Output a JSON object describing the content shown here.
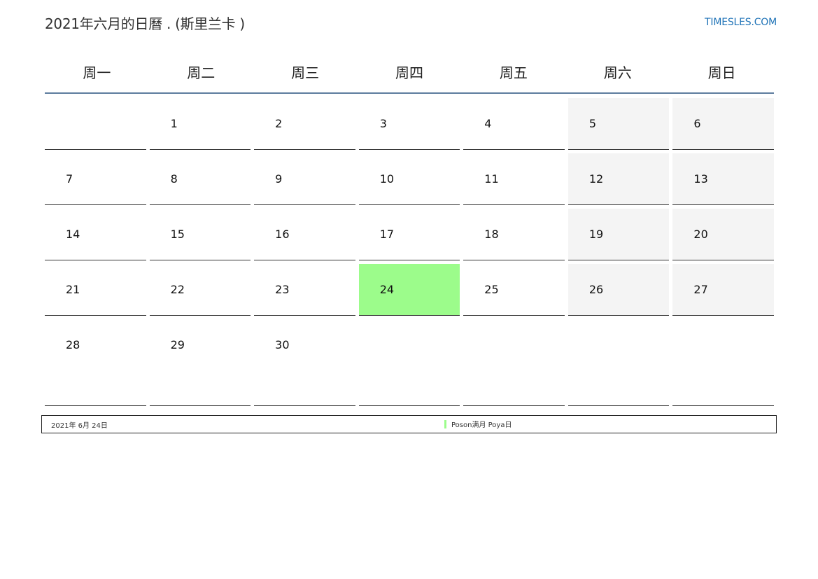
{
  "title": "2021年六月的日曆 . (斯里兰卡 )",
  "site": "TIMESLES.COM",
  "weekdays": [
    "周一",
    "周二",
    "周三",
    "周四",
    "周五",
    "周六",
    "周日"
  ],
  "weeks": [
    [
      "",
      "1",
      "2",
      "3",
      "4",
      "5",
      "6"
    ],
    [
      "7",
      "8",
      "9",
      "10",
      "11",
      "12",
      "13"
    ],
    [
      "14",
      "15",
      "16",
      "17",
      "18",
      "19",
      "20"
    ],
    [
      "21",
      "22",
      "23",
      "24",
      "25",
      "26",
      "27"
    ],
    [
      "28",
      "29",
      "30",
      "",
      "",
      "",
      ""
    ]
  ],
  "holiday_day": "24",
  "holiday_color": "#9cfc8b",
  "weekend_color": "#f4f4f4",
  "accent_color": "#5d7d9e",
  "legend": {
    "date": "2021年 6月 24日",
    "event": "Poson满月 Poya日"
  }
}
